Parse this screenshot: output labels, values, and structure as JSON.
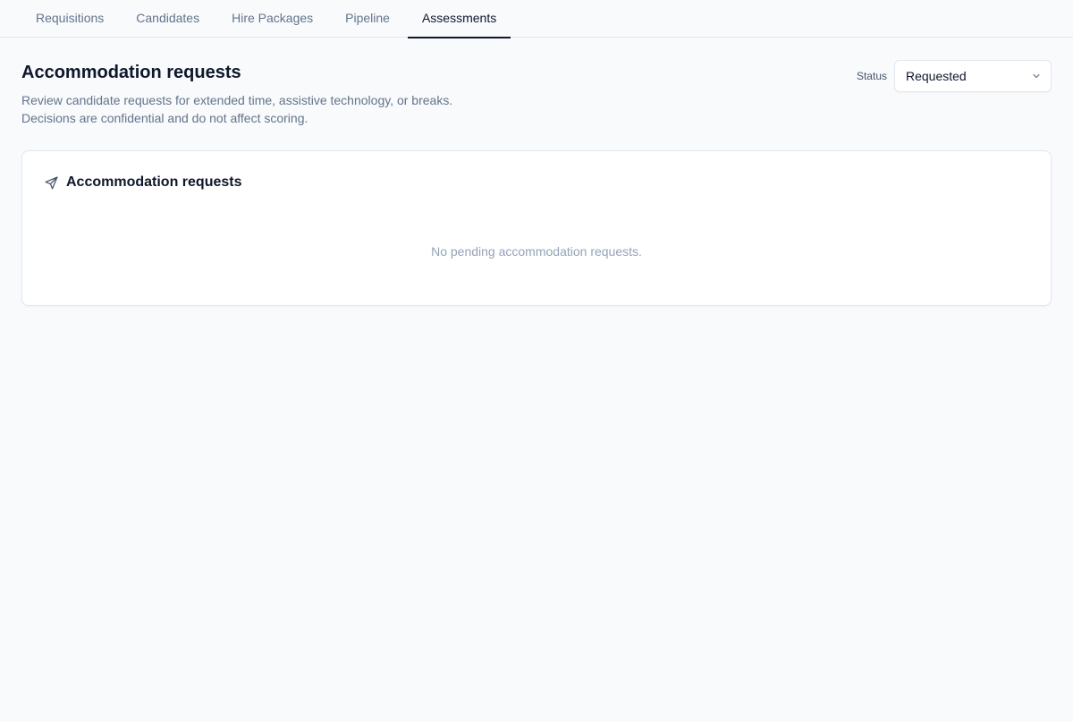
{
  "nav": {
    "tabs": [
      {
        "label": "Requisitions",
        "active": false
      },
      {
        "label": "Candidates",
        "active": false
      },
      {
        "label": "Hire Packages",
        "active": false
      },
      {
        "label": "Pipeline",
        "active": false
      },
      {
        "label": "Assessments",
        "active": true
      }
    ]
  },
  "header": {
    "title": "Accommodation requests",
    "subtitle_line1": "Review candidate requests for extended time, assistive technology, or breaks.",
    "subtitle_line2": "Decisions are confidential and do not affect scoring."
  },
  "filter": {
    "label": "Status",
    "selected": "Requested"
  },
  "card": {
    "icon": "send-icon",
    "title": "Accommodation requests",
    "empty_text": "No pending accommodation requests."
  },
  "colors": {
    "background": "#f8fafc",
    "text_primary": "#0f172a",
    "text_muted": "#64748b",
    "border": "#e2e8f0"
  }
}
